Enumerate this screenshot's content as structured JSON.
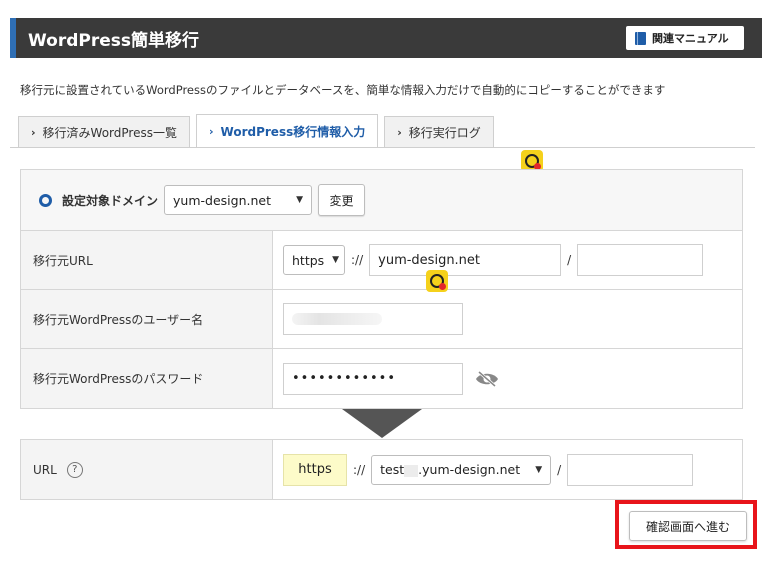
{
  "header": {
    "title": "WordPress簡単移行",
    "manual_label": "関連マニュアル",
    "accent": "#2f6fb5"
  },
  "description": "移行元に設置されているWordPressのファイルとデータベースを、簡単な情報入力だけで自動的にコピーすることができます",
  "tabs": [
    {
      "label": "移行済みWordPress一覧",
      "active": false
    },
    {
      "label": "WordPress移行情報入力",
      "active": true
    },
    {
      "label": "移行実行ログ",
      "active": false
    }
  ],
  "domain": {
    "label": "設定対象ドメイン",
    "selected": "yum-design.net",
    "change_label": "変更"
  },
  "source": {
    "url_label": "移行元URL",
    "protocol": "https",
    "separator": "://",
    "host": "yum-design.net",
    "slash": "/",
    "path": "",
    "user_label": "移行元WordPressのユーザー名",
    "password_label": "移行元WordPressのパスワード",
    "password_value": "••••••••••••"
  },
  "target": {
    "url_label": "URL",
    "help": "?",
    "protocol": "https",
    "separator": "://",
    "host_prefix": "test",
    "host_domain": ".yum-design.net",
    "slash": "/",
    "path": ""
  },
  "actions": {
    "next_label": "確認画面へ進む",
    "highlight_color": "#e8141a"
  }
}
